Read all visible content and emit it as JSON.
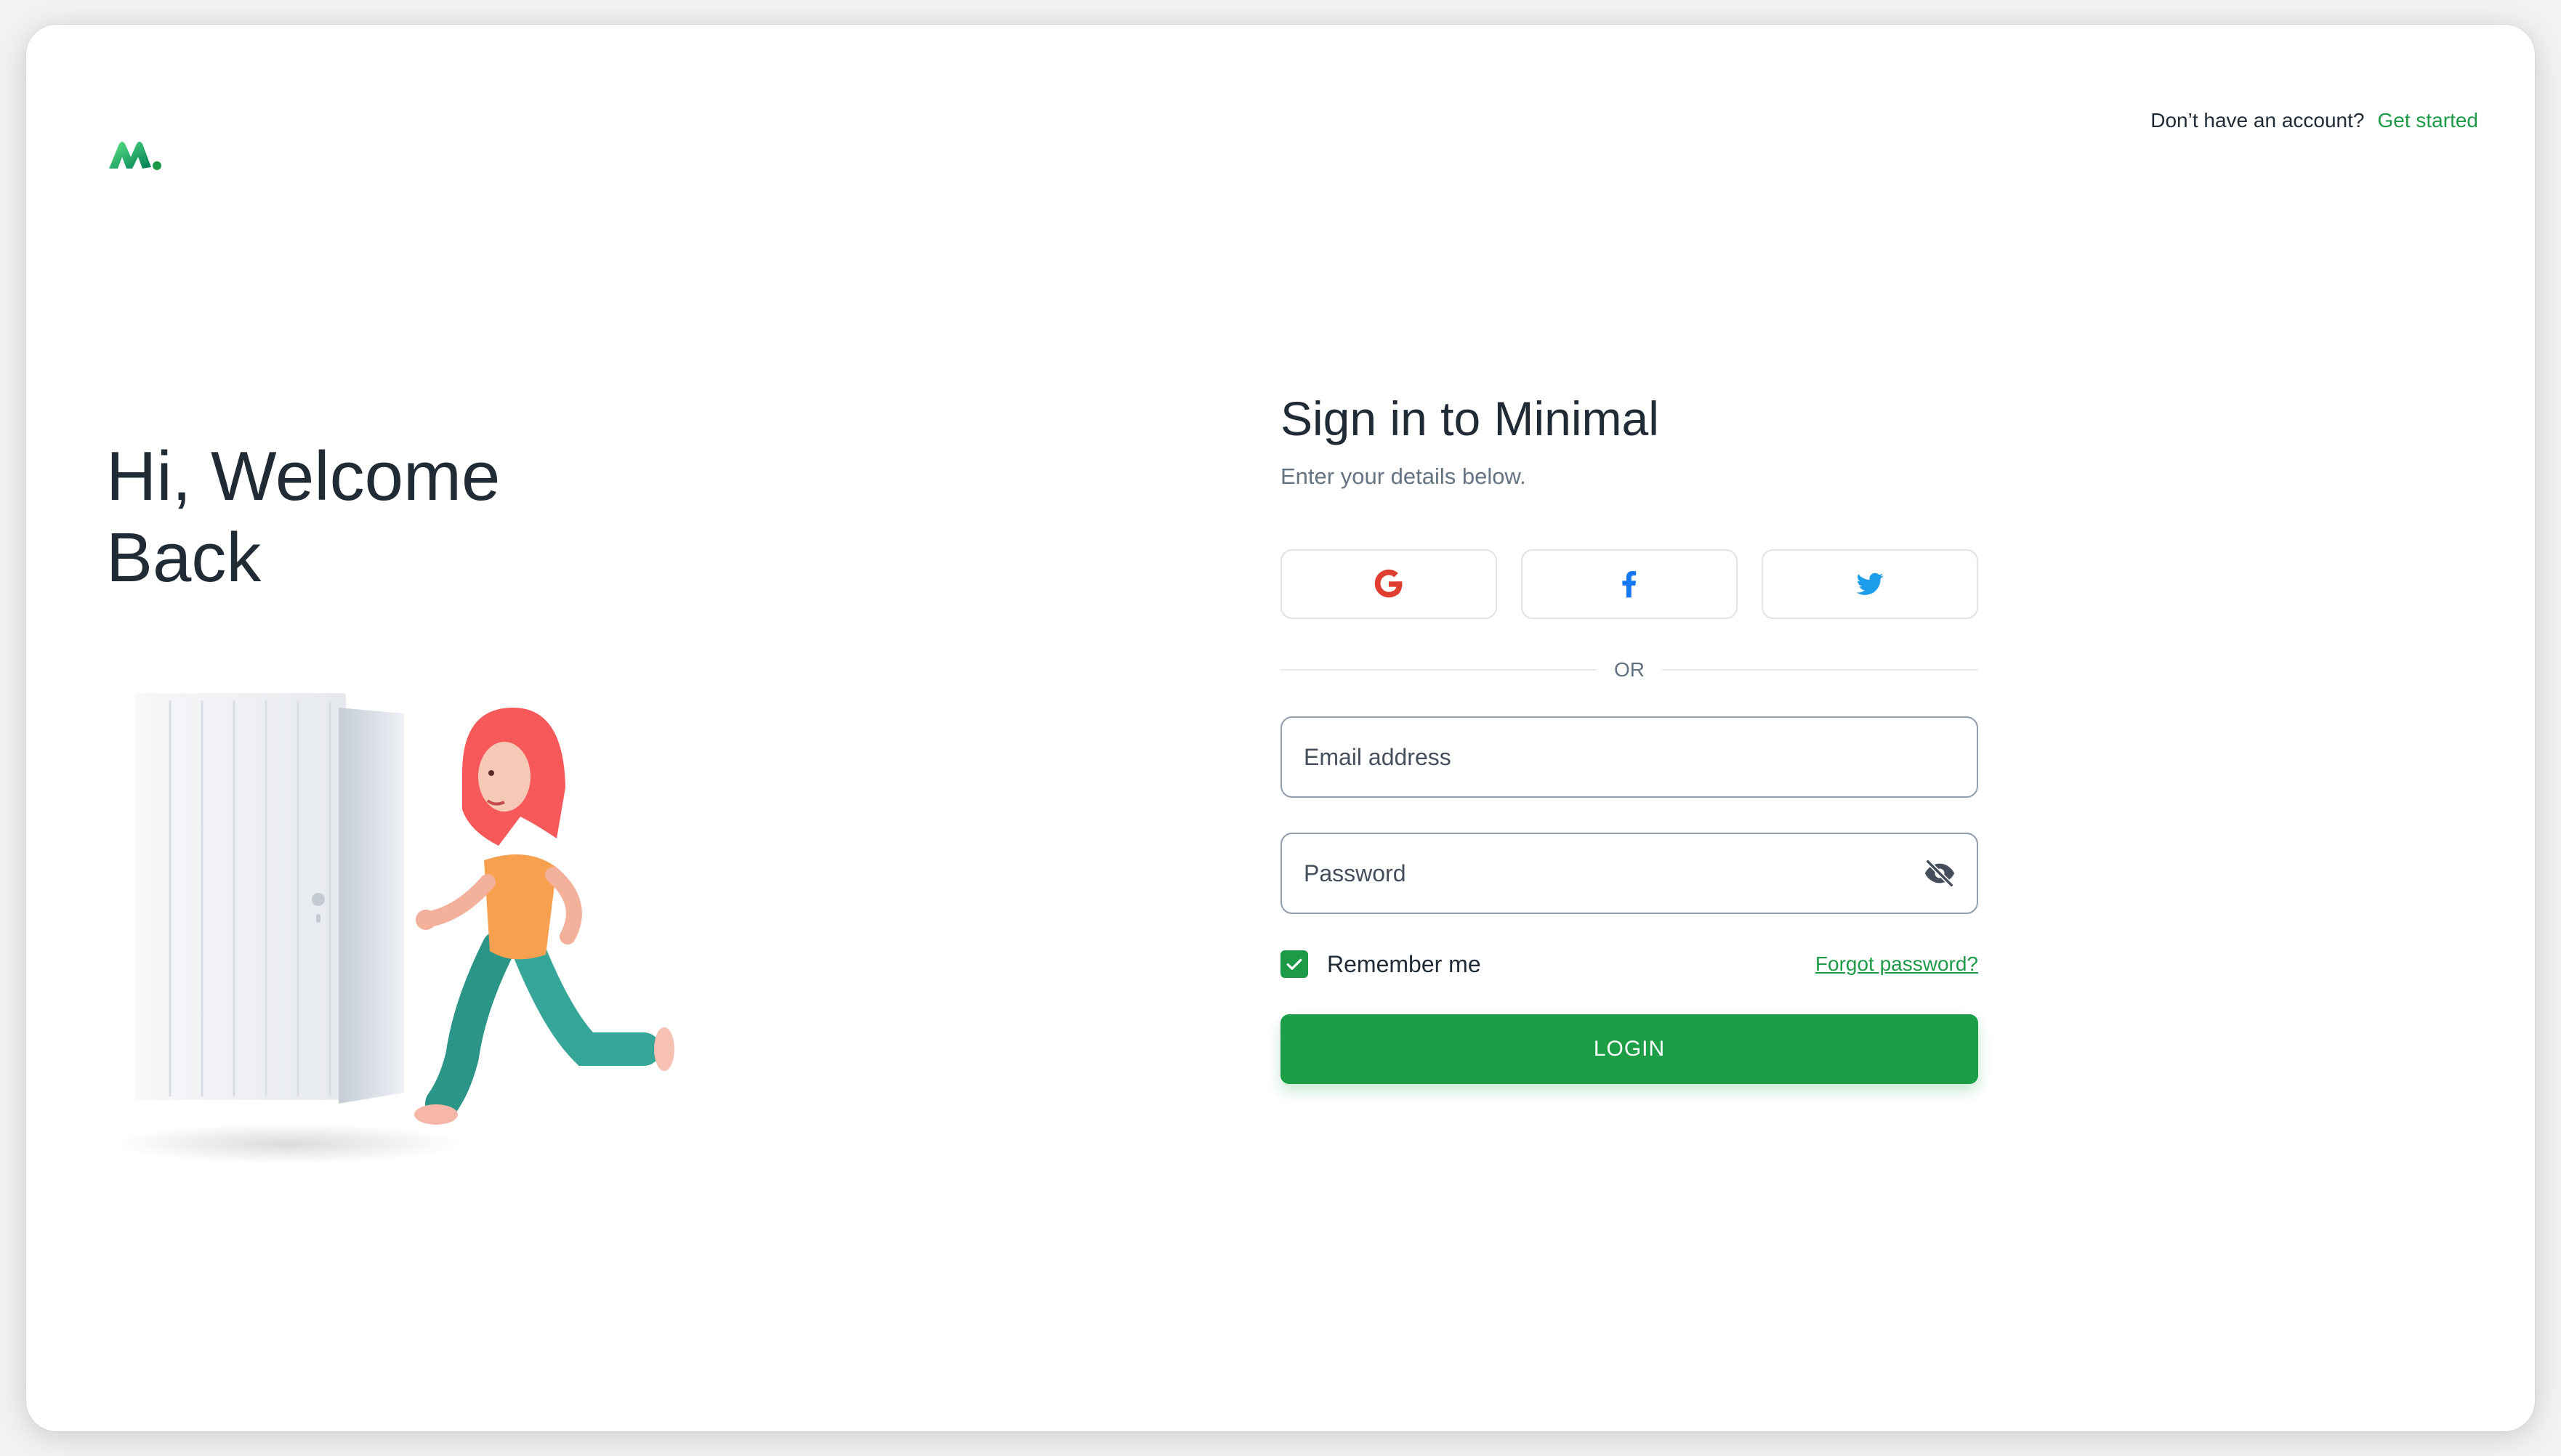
{
  "header": {
    "logo_icon": "minimal-logo-icon",
    "signup_prompt": "Don’t have an account?",
    "signup_link": "Get started"
  },
  "hero": {
    "title_line1": "Hi, Welcome",
    "title_line2": "Back",
    "illustration": "woman-running-through-door-illustration"
  },
  "form": {
    "title": "Sign in to Minimal",
    "subtitle": "Enter your details below.",
    "social_buttons": [
      {
        "icon": "google-icon",
        "color": "#df3e30"
      },
      {
        "icon": "facebook-icon",
        "color": "#1877f2"
      },
      {
        "icon": "twitter-icon",
        "color": "#1c9cea"
      }
    ],
    "divider_text": "OR",
    "email": {
      "placeholder": "Email address",
      "value": ""
    },
    "password": {
      "placeholder": "Password",
      "value": "",
      "toggle_icon": "eye-off-icon"
    },
    "remember_label": "Remember me",
    "remember_checked": true,
    "forgot_label": "Forgot password?",
    "login_label": "LOGIN"
  },
  "colors": {
    "primary": "#1b9e45",
    "text": "#212b36",
    "secondary_text": "#637381",
    "border": "#919eab"
  }
}
